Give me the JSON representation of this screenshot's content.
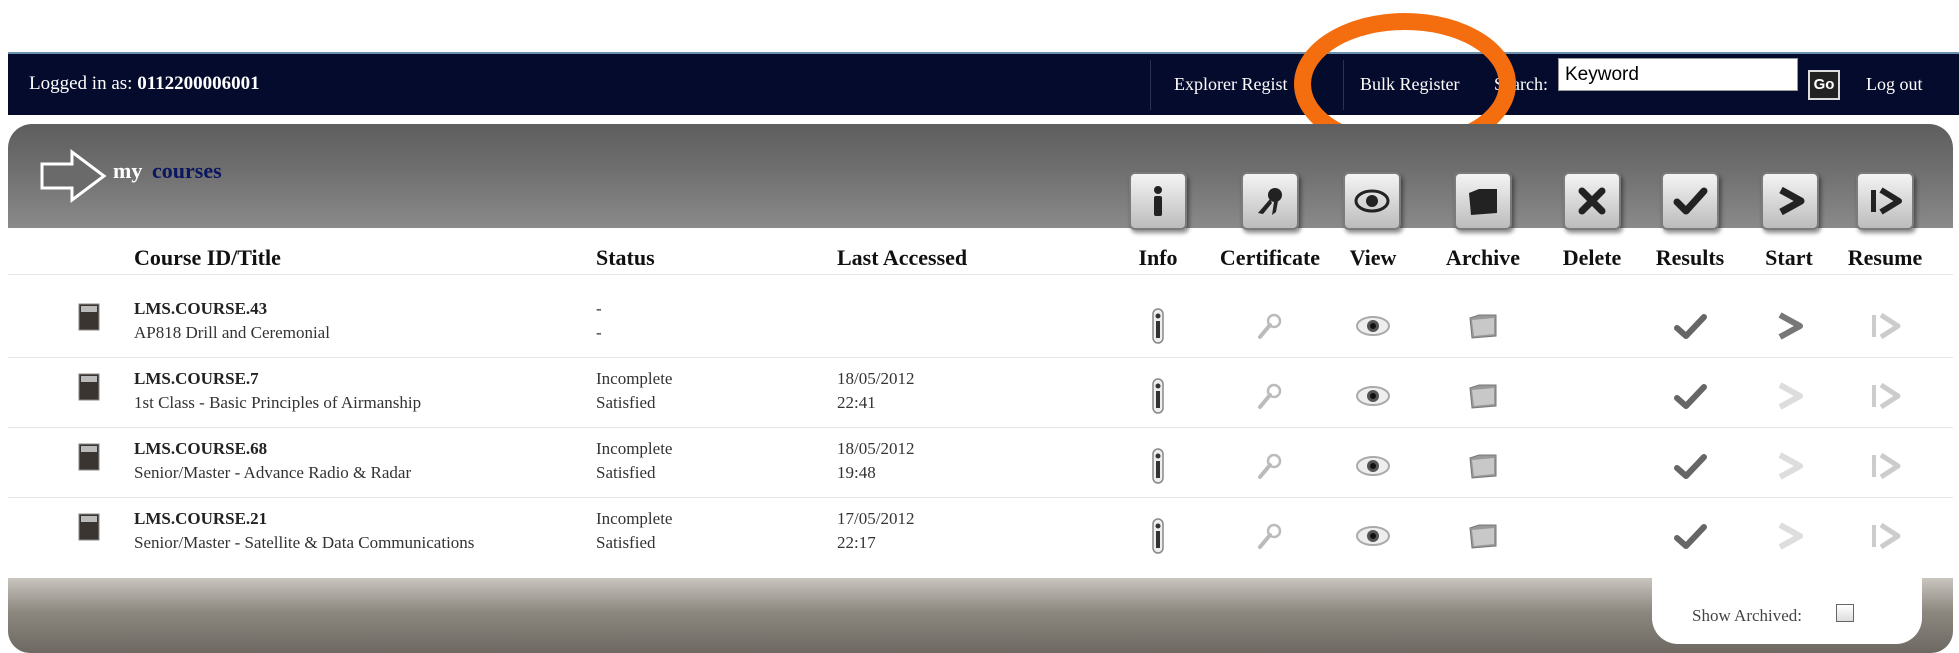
{
  "topbar": {
    "logged_label": "Logged in as:",
    "user_id": "0112200006001",
    "nav": [
      {
        "label": "Explorer Regist"
      },
      {
        "label": "Bulk Register"
      }
    ],
    "search_label": "Search:",
    "search_value": "Keyword",
    "go_label": "Go",
    "logout_label": "Log out"
  },
  "annotation": {
    "color": "#f46e0f"
  },
  "header": {
    "title_my": "my",
    "title_courses": "courses"
  },
  "columns": {
    "course": "Course ID/Title",
    "status": "Status",
    "last_accessed": "Last Accessed",
    "info": "Info",
    "certificate": "Certificate",
    "view": "View",
    "archive": "Archive",
    "delete": "Delete",
    "results": "Results",
    "start": "Start",
    "resume": "Resume"
  },
  "toolbar_icons": [
    "info-icon",
    "certificate-icon",
    "view-icon",
    "archive-icon",
    "delete-icon",
    "results-icon",
    "start-icon",
    "resume-icon"
  ],
  "courses": [
    {
      "id": "LMS.COURSE.43",
      "title": "AP818 Drill and Ceremonial",
      "status1": "-",
      "status2": "-",
      "date": "",
      "time": "",
      "start_active": true
    },
    {
      "id": "LMS.COURSE.7",
      "title": "1st Class - Basic Principles of Airmanship",
      "status1": "Incomplete",
      "status2": "Satisfied",
      "date": "18/05/2012",
      "time": "22:41",
      "start_active": false
    },
    {
      "id": "LMS.COURSE.68",
      "title": "Senior/Master - Advance Radio & Radar",
      "status1": "Incomplete",
      "status2": "Satisfied",
      "date": "18/05/2012",
      "time": "19:48",
      "start_active": false
    },
    {
      "id": "LMS.COURSE.21",
      "title": "Senior/Master - Satellite & Data Communications",
      "status1": "Incomplete",
      "status2": "Satisfied",
      "date": "17/05/2012",
      "time": "22:17",
      "start_active": false
    }
  ],
  "footer": {
    "show_archived_label": "Show Archived:",
    "show_archived_checked": false
  }
}
